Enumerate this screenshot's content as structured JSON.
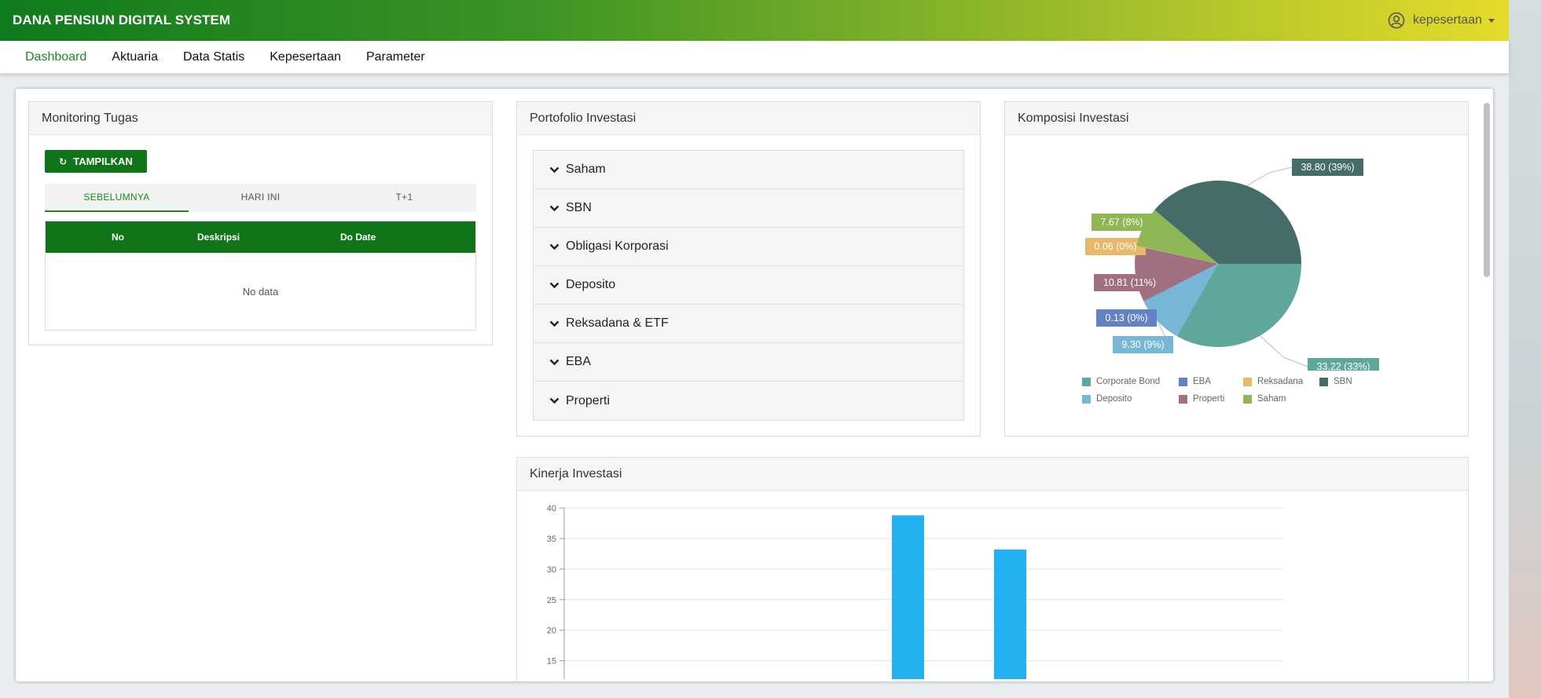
{
  "app": {
    "title": "DANA PENSIUN DIGITAL SYSTEM",
    "user": "kepesertaan"
  },
  "nav": [
    "Dashboard",
    "Aktuaria",
    "Data Statis",
    "Kepesertaan",
    "Parameter"
  ],
  "monitoring": {
    "title": "Monitoring Tugas",
    "button": "TAMPILKAN",
    "tabs": [
      "SEBELUMNYA",
      "HARI INI",
      "T+1"
    ],
    "columns": [
      "No",
      "Deskripsi",
      "Do Date"
    ],
    "empty": "No data"
  },
  "portfolio": {
    "title": "Portofolio Investasi",
    "items": [
      "Saham",
      "SBN",
      "Obligasi Korporasi",
      "Deposito",
      "Reksadana & ETF",
      "EBA",
      "Properti"
    ]
  },
  "composition": {
    "title": "Komposisi Investasi",
    "chart_data": {
      "type": "pie",
      "slices": [
        {
          "name": "SBN",
          "value": 38.8,
          "label": "38.80 (39%)",
          "color": "#456c69"
        },
        {
          "name": "Corporate Bond",
          "value": 33.22,
          "label": "33.22 (33%)",
          "color": "#5fa69c"
        },
        {
          "name": "Deposito",
          "value": 9.3,
          "label": "9.30 (9%)",
          "color": "#78b6d6"
        },
        {
          "name": "EBA",
          "value": 0.13,
          "label": "0.13 (0%)",
          "color": "#6482c2"
        },
        {
          "name": "Properti",
          "value": 10.81,
          "label": "10.81 (11%)",
          "color": "#a1707e"
        },
        {
          "name": "Reksadana",
          "value": 0.06,
          "label": "0.06 (0%)",
          "color": "#e8b86a"
        },
        {
          "name": "Saham",
          "value": 7.67,
          "label": "7.67 (8%)",
          "color": "#8fb654"
        }
      ],
      "legend": [
        "Corporate Bond",
        "EBA",
        "Reksadana",
        "SBN",
        "Deposito",
        "Properti",
        "Saham"
      ],
      "legend_position": "bottom"
    }
  },
  "performance": {
    "title": "Kinerja Investasi",
    "chart_data": {
      "type": "bar",
      "values": [
        38.8,
        33.22
      ],
      "ylim": [
        12,
        40
      ],
      "yticks": [
        "40",
        "35",
        "30",
        "25",
        "20",
        "15"
      ],
      "color": "#22b0f0",
      "grid": true
    }
  }
}
